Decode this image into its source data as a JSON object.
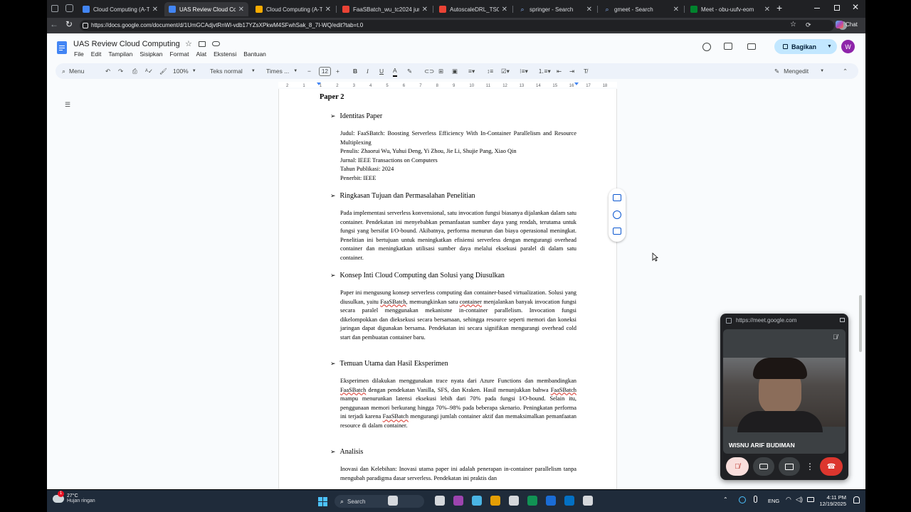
{
  "browser": {
    "tabs": [
      {
        "title": "Cloud Computing (A-TM-5)",
        "icon": "docs-icon",
        "color": "#4285f4",
        "active": false
      },
      {
        "title": "UAS Review Cloud Computi",
        "icon": "docs-icon",
        "color": "#4285f4",
        "active": true
      },
      {
        "title": "Cloud Computing (A-TM-5)",
        "icon": "classroom-icon",
        "color": "#f9ab00",
        "active": false
      },
      {
        "title": "FaaSBatch_wu_tc2024 jurna",
        "icon": "pdf-icon",
        "color": "#ea4335",
        "active": false
      },
      {
        "title": "AutoscaleDRL_TSC2024 jurn",
        "icon": "pdf-icon",
        "color": "#ea4335",
        "active": false
      },
      {
        "title": "springer - Search",
        "icon": "search-icon",
        "color": "#8ab4f8",
        "active": false
      },
      {
        "title": "gmeet - Search",
        "icon": "search-icon",
        "color": "#8ab4f8",
        "active": false
      },
      {
        "title": "Meet - obu-uufv-eom",
        "icon": "meet-icon",
        "color": "#00832d",
        "active": false
      }
    ],
    "url": "https://docs.google.com/document/d/1UmGCAdjvtRnWl-vdb17YZsXPkwM4SFwhSak_8_7I-WQ/edit?tab=t.0",
    "chat_label": "Chat"
  },
  "docs": {
    "title": "UAS Review Cloud Computing",
    "menu": [
      "File",
      "Edit",
      "Tampilan",
      "Sisipkan",
      "Format",
      "Alat",
      "Ekstensi",
      "Bantuan"
    ],
    "share_label": "Bagikan",
    "avatar_letter": "W",
    "toolbar": {
      "search_menu": "Menu",
      "zoom": "100%",
      "style": "Teks normal",
      "font": "Times ...",
      "font_size": "12",
      "mode": "Mengedit"
    },
    "ruler_numbers": [
      "2",
      "1",
      "1",
      "2",
      "3",
      "4",
      "5",
      "6",
      "7",
      "8",
      "9",
      "10",
      "11",
      "12",
      "13",
      "14",
      "15",
      "16",
      "17",
      "18"
    ]
  },
  "document": {
    "heading": "Paper 2",
    "sections": [
      {
        "title": "Identitas Paper"
      },
      {
        "title": "Ringkasan Tujuan dan Permasalahan Penelitian"
      },
      {
        "title": "Konsep Inti Cloud Computing dan Solusi yang Diusulkan"
      },
      {
        "title": "Temuan Utama dan Hasil Eksperimen"
      },
      {
        "title": "Analisis"
      }
    ],
    "identity": [
      "Judul: FaaSBatch: Boosting Serverless Efficiency With In-Container Parallelism and Resource Multiplexing",
      "Penulis: Zhaorui Wu, Yuhui Deng, Yi Zhou, Jie Li, Shujie Pang, Xiao Qin",
      "Jurnal: IEEE Transactions on Computers",
      "Tahun Publikasi: 2024",
      "Penerbit: IEEE"
    ],
    "para_ringkasan": "Pada implementasi serverless konvensional, satu invocation fungsi biasanya dijalankan dalam satu container. Pendekatan ini menyebabkan pemanfaatan sumber daya yang rendah, terutama untuk fungsi yang bersifat I/O-bound. Akibatnya, performa menurun dan biaya operasional meningkat. Penelitian ini bertujuan untuk meningkatkan efisiensi serverless dengan mengurangi overhead container dan meningkatkan utilisasi sumber daya melalui eksekusi paralel di dalam satu container.",
    "para_konsep": [
      "Paper ini mengusung konsep serverless computing dan container-based virtualization. Solusi yang diusulkan, yaitu ",
      "FaaSBatch",
      ", memungkinkan satu ",
      "container",
      " menjalankan banyak invocation fungsi secara paralel menggunakan mekanisme in-container parallelism. Invocation fungsi dikelompokkan dan dieksekusi secara bersamaan, sehingga resource seperti memori dan koneksi jaringan dapat digunakan bersama. Pendekatan ini secara signifikan mengurangi overhead cold start dan pembuatan container baru."
    ],
    "para_temuan": [
      "Eksperimen dilakukan menggunakan trace nyata dari Azure Functions dan membandingkan ",
      "FaaSBatch",
      " dengan pendekatan Vanilla, SFS, dan Kraken. Hasil menunjukkan bahwa ",
      "FaaSBatch",
      " mampu menurunkan latensi eksekusi lebih dari 70% pada fungsi I/O-bound. Selain itu, penggunaan memori berkurang hingga 70%–98% pada beberapa skenario. Peningkatan performa ini terjadi karena ",
      "FaaSBatch",
      " mengurangi jumlah container aktif dan memaksimalkan pemanfaatan resource di dalam container."
    ],
    "para_analisis": "Inovasi dan Kelebihan: Inovasi utama paper ini adalah penerapan in-container parallelism tanpa mengubah paradigma dasar serverless. Pendekatan ini praktis dan"
  },
  "meet": {
    "url": "https://meet.google.com",
    "participant": "WISNU ARIF BUDIMAN"
  },
  "taskbar": {
    "weather_temp": "27°C",
    "weather_desc": "Hujan ringan",
    "weather_badge": "1",
    "search_placeholder": "Search",
    "lang": "ENG",
    "time": "4:11 PM",
    "date": "12/19/2025"
  }
}
